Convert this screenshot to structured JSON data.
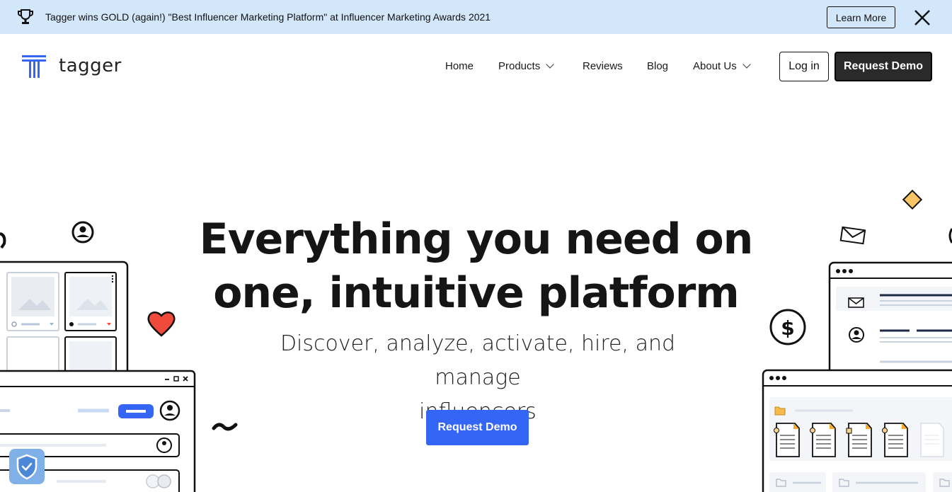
{
  "announcement": {
    "message": "Tagger wins GOLD (again!) \"Best Influencer Marketing Platform\" at Influencer Marketing Awards 2021",
    "learn_more": "Learn More"
  },
  "brand": {
    "name": "tagger",
    "accent": "#3565f5"
  },
  "nav": {
    "items": [
      {
        "label": "Home"
      },
      {
        "label": "Products"
      },
      {
        "label": "Reviews"
      },
      {
        "label": "Blog"
      },
      {
        "label": "About Us"
      }
    ],
    "login": "Log in",
    "request_demo": "Request Demo"
  },
  "hero": {
    "title_line1": "Everything you need on",
    "title_line2": "one, intuitive platform",
    "subtitle_line1": "Discover, analyze, activate, hire, and manage",
    "subtitle_line2": "influencers",
    "cta": "Request Demo"
  }
}
